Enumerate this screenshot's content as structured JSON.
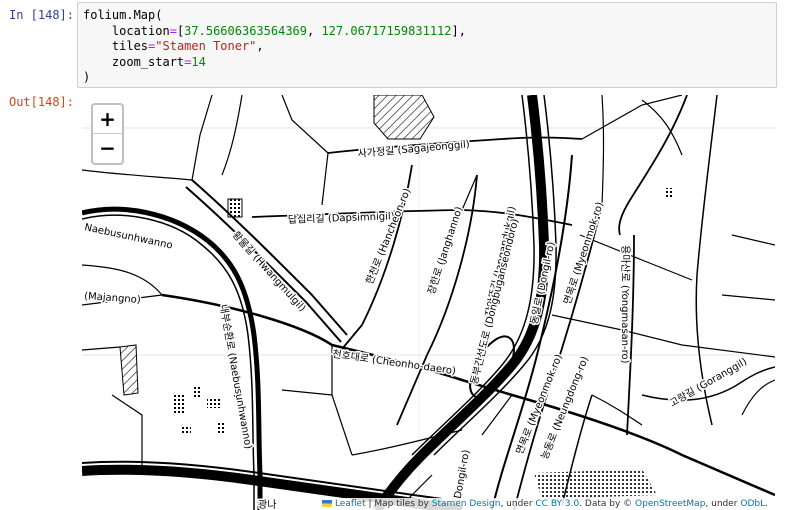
{
  "cell": {
    "in_prompt": "In [148]:",
    "out_prompt": "Out[148]:",
    "code": {
      "l1": "folium.Map(",
      "l2_key": "location",
      "l2_lat": "37.56606363564369",
      "l2_lon": "127.06717159831112",
      "l3_key": "tiles",
      "l3_val": "\"Stamen Toner\"",
      "l4_key": "zoom_start",
      "l4_val": "14",
      "l5": ")"
    }
  },
  "map": {
    "zoom_in": "+",
    "zoom_out": "−",
    "labels": {
      "sagajeonggil": "사가정길 (Sagajeonggil)",
      "dapsimnigil": "답십리길 (Dapsimnigil)",
      "naebusunhwanno": "Naebusunhwanno",
      "hwangmulgil": "황물길 (Hwangmulgil)",
      "majangno": "(Majangno)",
      "hancheon": "한천로 (Hancheon-ro)",
      "janghanno": "장한로 (Janghanno)",
      "jangandukgil": "장안뚝길 (Jangandukgil)",
      "dongbugan": "동부간선도로 (Dongbuganseondoro)",
      "dongil": "동일로 (Dongil-ro)",
      "myeonmok": "면목로 (Myeonmok-ro)",
      "yongmasan": "용마산로 (Yongmasan-ro)",
      "cheonho": "천호대로 (Cheonho-daero)",
      "naebu_vertical": "내부순환로 (Naebusunhwanno)",
      "myeonmok2": "면목로 (Myeonmok-ro)",
      "neungdong": "능동로 (Neungdong-ro)",
      "dongil2": "(Dongil-ro)",
      "goranggil": "고랑길 (Goranggil)",
      "bottom_partial": "광나"
    },
    "attribution": {
      "leaflet": "Leaflet",
      "t1": " | Map tiles by ",
      "stamen": "Stamen Design",
      "t2": ", under ",
      "ccby": "CC BY 3.0",
      "t3": ". Data by © ",
      "osm": "OpenStreetMap",
      "t4": ", under ",
      "odbl": "ODbL",
      "t5": "."
    }
  }
}
